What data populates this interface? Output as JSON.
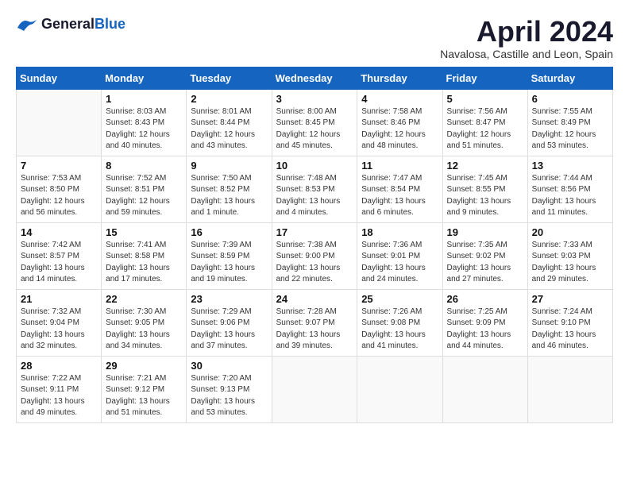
{
  "logo": {
    "general": "General",
    "blue": "Blue"
  },
  "title": "April 2024",
  "location": "Navalosa, Castille and Leon, Spain",
  "days_header": [
    "Sunday",
    "Monday",
    "Tuesday",
    "Wednesday",
    "Thursday",
    "Friday",
    "Saturday"
  ],
  "weeks": [
    [
      {
        "day": "",
        "info": ""
      },
      {
        "day": "1",
        "info": "Sunrise: 8:03 AM\nSunset: 8:43 PM\nDaylight: 12 hours\nand 40 minutes."
      },
      {
        "day": "2",
        "info": "Sunrise: 8:01 AM\nSunset: 8:44 PM\nDaylight: 12 hours\nand 43 minutes."
      },
      {
        "day": "3",
        "info": "Sunrise: 8:00 AM\nSunset: 8:45 PM\nDaylight: 12 hours\nand 45 minutes."
      },
      {
        "day": "4",
        "info": "Sunrise: 7:58 AM\nSunset: 8:46 PM\nDaylight: 12 hours\nand 48 minutes."
      },
      {
        "day": "5",
        "info": "Sunrise: 7:56 AM\nSunset: 8:47 PM\nDaylight: 12 hours\nand 51 minutes."
      },
      {
        "day": "6",
        "info": "Sunrise: 7:55 AM\nSunset: 8:49 PM\nDaylight: 12 hours\nand 53 minutes."
      }
    ],
    [
      {
        "day": "7",
        "info": "Sunrise: 7:53 AM\nSunset: 8:50 PM\nDaylight: 12 hours\nand 56 minutes."
      },
      {
        "day": "8",
        "info": "Sunrise: 7:52 AM\nSunset: 8:51 PM\nDaylight: 12 hours\nand 59 minutes."
      },
      {
        "day": "9",
        "info": "Sunrise: 7:50 AM\nSunset: 8:52 PM\nDaylight: 13 hours\nand 1 minute."
      },
      {
        "day": "10",
        "info": "Sunrise: 7:48 AM\nSunset: 8:53 PM\nDaylight: 13 hours\nand 4 minutes."
      },
      {
        "day": "11",
        "info": "Sunrise: 7:47 AM\nSunset: 8:54 PM\nDaylight: 13 hours\nand 6 minutes."
      },
      {
        "day": "12",
        "info": "Sunrise: 7:45 AM\nSunset: 8:55 PM\nDaylight: 13 hours\nand 9 minutes."
      },
      {
        "day": "13",
        "info": "Sunrise: 7:44 AM\nSunset: 8:56 PM\nDaylight: 13 hours\nand 11 minutes."
      }
    ],
    [
      {
        "day": "14",
        "info": "Sunrise: 7:42 AM\nSunset: 8:57 PM\nDaylight: 13 hours\nand 14 minutes."
      },
      {
        "day": "15",
        "info": "Sunrise: 7:41 AM\nSunset: 8:58 PM\nDaylight: 13 hours\nand 17 minutes."
      },
      {
        "day": "16",
        "info": "Sunrise: 7:39 AM\nSunset: 8:59 PM\nDaylight: 13 hours\nand 19 minutes."
      },
      {
        "day": "17",
        "info": "Sunrise: 7:38 AM\nSunset: 9:00 PM\nDaylight: 13 hours\nand 22 minutes."
      },
      {
        "day": "18",
        "info": "Sunrise: 7:36 AM\nSunset: 9:01 PM\nDaylight: 13 hours\nand 24 minutes."
      },
      {
        "day": "19",
        "info": "Sunrise: 7:35 AM\nSunset: 9:02 PM\nDaylight: 13 hours\nand 27 minutes."
      },
      {
        "day": "20",
        "info": "Sunrise: 7:33 AM\nSunset: 9:03 PM\nDaylight: 13 hours\nand 29 minutes."
      }
    ],
    [
      {
        "day": "21",
        "info": "Sunrise: 7:32 AM\nSunset: 9:04 PM\nDaylight: 13 hours\nand 32 minutes."
      },
      {
        "day": "22",
        "info": "Sunrise: 7:30 AM\nSunset: 9:05 PM\nDaylight: 13 hours\nand 34 minutes."
      },
      {
        "day": "23",
        "info": "Sunrise: 7:29 AM\nSunset: 9:06 PM\nDaylight: 13 hours\nand 37 minutes."
      },
      {
        "day": "24",
        "info": "Sunrise: 7:28 AM\nSunset: 9:07 PM\nDaylight: 13 hours\nand 39 minutes."
      },
      {
        "day": "25",
        "info": "Sunrise: 7:26 AM\nSunset: 9:08 PM\nDaylight: 13 hours\nand 41 minutes."
      },
      {
        "day": "26",
        "info": "Sunrise: 7:25 AM\nSunset: 9:09 PM\nDaylight: 13 hours\nand 44 minutes."
      },
      {
        "day": "27",
        "info": "Sunrise: 7:24 AM\nSunset: 9:10 PM\nDaylight: 13 hours\nand 46 minutes."
      }
    ],
    [
      {
        "day": "28",
        "info": "Sunrise: 7:22 AM\nSunset: 9:11 PM\nDaylight: 13 hours\nand 49 minutes."
      },
      {
        "day": "29",
        "info": "Sunrise: 7:21 AM\nSunset: 9:12 PM\nDaylight: 13 hours\nand 51 minutes."
      },
      {
        "day": "30",
        "info": "Sunrise: 7:20 AM\nSunset: 9:13 PM\nDaylight: 13 hours\nand 53 minutes."
      },
      {
        "day": "",
        "info": ""
      },
      {
        "day": "",
        "info": ""
      },
      {
        "day": "",
        "info": ""
      },
      {
        "day": "",
        "info": ""
      }
    ]
  ]
}
